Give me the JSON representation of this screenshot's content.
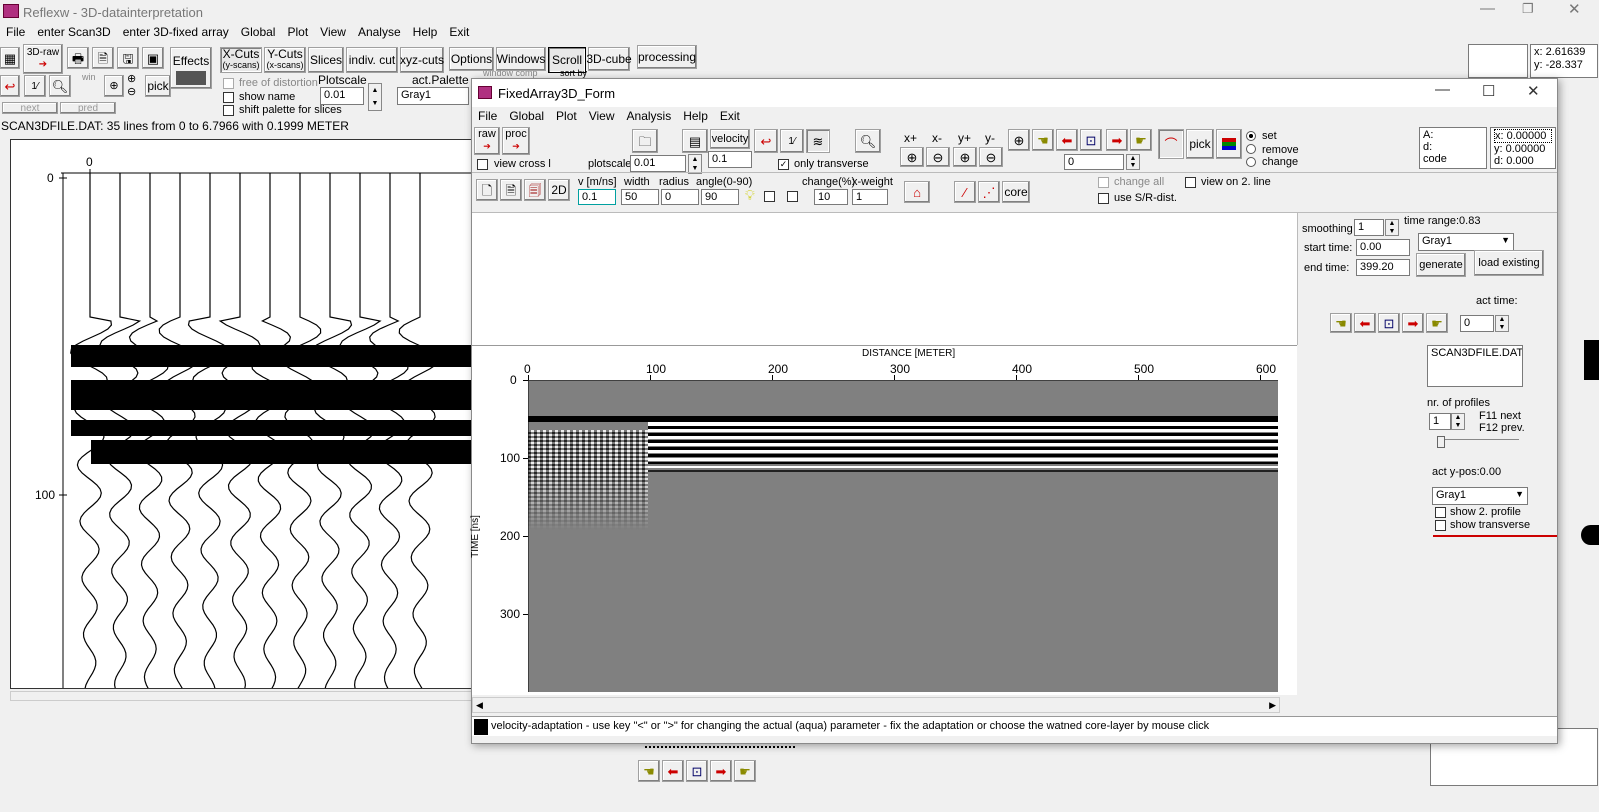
{
  "main": {
    "title": "Reflexw - 3D-datainterpretation",
    "menu": [
      "File",
      "enter Scan3D",
      "enter 3D-fixed array",
      "Global",
      "Plot",
      "View",
      "Analyse",
      "Help",
      "Exit"
    ],
    "toolbar": {
      "raw": "3D-raw",
      "effects": "Effects",
      "pick": "pick",
      "win": "win",
      "xcuts": "X-Cuts",
      "xcuts_sub": "(y-scans)",
      "ycuts": "Y-Cuts",
      "ycuts_sub": "(x-scans)",
      "slices": "Slices",
      "indiv": "indiv. cut",
      "xyz": "xyz-cuts",
      "options": "Options",
      "windows": "Windows",
      "scroll": "Scroll",
      "cube": "3D-cube",
      "processing": "processing",
      "free_distortion": "free of distortion",
      "show_name": "show name",
      "shift_palette": "shift palette for slices",
      "plotscale_label": "Plotscale",
      "plotscale_value": "0.01",
      "palette_label": "act.Palette",
      "palette_value": "Gray1",
      "window_comp": "window comp",
      "sort_by": "sort by",
      "next": "next",
      "pred": "pred"
    },
    "coords": {
      "x": "x: 2.61639",
      "y": "y: -28.337"
    },
    "status": "SCAN3DFILE.DAT: 35 lines from 0 to 6.7966 with 0.1999 METER",
    "plot": {
      "x_tick": "0",
      "y_ticks": [
        "0",
        "100"
      ]
    }
  },
  "dialog": {
    "title": "FixedArray3D_Form",
    "menu": [
      "File",
      "Global",
      "Plot",
      "View",
      "Analysis",
      "Help",
      "Exit"
    ],
    "tb": {
      "raw": "raw",
      "proc": "proc",
      "velocity": "velocity",
      "velocity_value": "0.1",
      "view_cross": "view cross l",
      "plotscale_label": "plotscale",
      "plotscale_value": "0.01",
      "only_transverse": "only transverse",
      "xplus": "x+",
      "xminus": "x-",
      "yplus": "y+",
      "yminus": "y-",
      "pick": "pick",
      "set": "set",
      "remove": "remove",
      "change": "change",
      "counter": "0",
      "A": "A:",
      "d": "d:",
      "code": "code",
      "cx": "x: 0.00000",
      "cy": "y: 0.00000",
      "cd": "d: 0.000"
    },
    "tb2": {
      "twod": "2D",
      "v_label": "v [m/ns]",
      "v_value": "0.1",
      "width_label": "width",
      "width_value": "50",
      "radius_label": "radius",
      "radius_value": "0",
      "angle_label": "angle(0-90)",
      "angle_value": "90",
      "change_label": "change(%)",
      "change_value": "10",
      "xweight_label": "x-weight",
      "xweight_value": "1",
      "core": "core",
      "change_all": "change all",
      "use_sr": "use S/R-dist.",
      "view_on2": "view on 2. line"
    },
    "right": {
      "smoothing_label": "smoothing",
      "smoothing_value": "1",
      "time_range": "time range:0.83",
      "palette": "Gray1",
      "start_label": "start time:",
      "start_value": "0.00",
      "end_label": "end time:",
      "end_value": "399.20",
      "generate": "generate",
      "load_existing": "load existing",
      "act_time": "act time:",
      "act_time_value": "0",
      "file": "SCAN3DFILE.DAT",
      "nr_profiles": "nr. of profiles",
      "nr_value": "1",
      "f11": "F11 next",
      "f12": "F12 prev.",
      "act_ypos": "act y-pos:0.00",
      "palette2": "Gray1",
      "show2": "show 2. profile",
      "show_trans": "show transverse"
    },
    "plot": {
      "xlabel": "DISTANCE [METER]",
      "ylabel": "TIME [ns]",
      "xticks": [
        "0",
        "100",
        "200",
        "300",
        "400",
        "500",
        "600"
      ],
      "yticks": [
        "0",
        "100",
        "200",
        "300"
      ]
    },
    "statusbar": "velocity-adaptation - use key \"<\" or \">\" for changing the actual (aqua) parameter - fix the adaptation or choose the watned core-layer by mouse click"
  },
  "colors": {
    "accent": "#cc0000",
    "plot_bg": "#808080"
  }
}
